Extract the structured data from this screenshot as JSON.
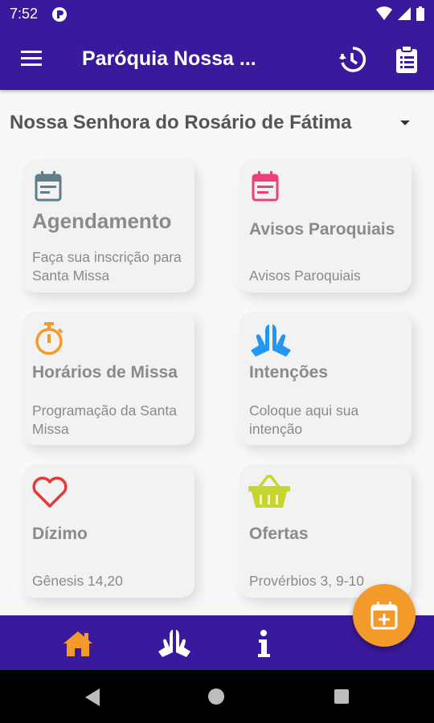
{
  "status": {
    "time": "7:52"
  },
  "appbar": {
    "title": "Paróquia Nossa ..."
  },
  "parish": {
    "selected": "Nossa Senhora do Rosário de Fátima"
  },
  "cards": [
    {
      "title": "Agendamento",
      "subtitle": "Faça sua inscrição para Santa Missa",
      "icon": "calendar-icon",
      "color": "#607d8b"
    },
    {
      "title": "Avisos Paroquiais",
      "subtitle": "Avisos Paroquiais",
      "icon": "calendar-notes-icon",
      "color": "#ec407a"
    },
    {
      "title": "Horários de Missa",
      "subtitle": "Programação da Santa Missa",
      "icon": "stopwatch-icon",
      "color": "#f39a2b"
    },
    {
      "title": "Intenções",
      "subtitle": "Coloque aqui sua intenção",
      "icon": "praying-hands-icon",
      "color": "#2196f3"
    },
    {
      "title": "Dízimo",
      "subtitle": "Gênesis 14,20",
      "icon": "heart-icon",
      "color": "#e53935"
    },
    {
      "title": "Ofertas",
      "subtitle": "Provérbios 3, 9-10",
      "icon": "basket-icon",
      "color": "#c6d530"
    }
  ],
  "colors": {
    "primary": "#3a1a9c",
    "accent": "#f39a2b"
  }
}
